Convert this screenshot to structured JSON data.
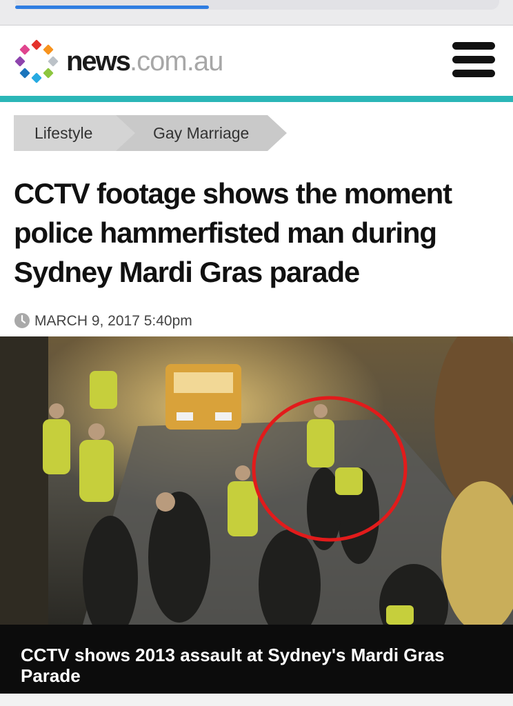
{
  "browser": {
    "load_progress": 0.4
  },
  "site": {
    "brand_main": "news",
    "brand_suffix": ".com.au",
    "accent_color": "#2bb6b7",
    "logo_dot_colors": [
      "#e4322b",
      "#f7931e",
      "#bcc2c8",
      "#8dc63f",
      "#27aae1",
      "#1c75bc",
      "#8e44ad",
      "#e0458e"
    ]
  },
  "header": {
    "menu_icon": "hamburger-icon"
  },
  "breadcrumb": {
    "items": [
      {
        "label": "Lifestyle"
      },
      {
        "label": "Gay Marriage"
      }
    ]
  },
  "article": {
    "headline": "CCTV footage shows the moment police hammerfisted man during Sydney Mardi Gras parade",
    "date_icon": "clock-icon",
    "date": "MARCH 9, 2017 5:40pm"
  },
  "video": {
    "caption": "CCTV shows 2013 assault at Sydney's Mardi Gras Parade",
    "highlight_color": "#e21b1b"
  }
}
